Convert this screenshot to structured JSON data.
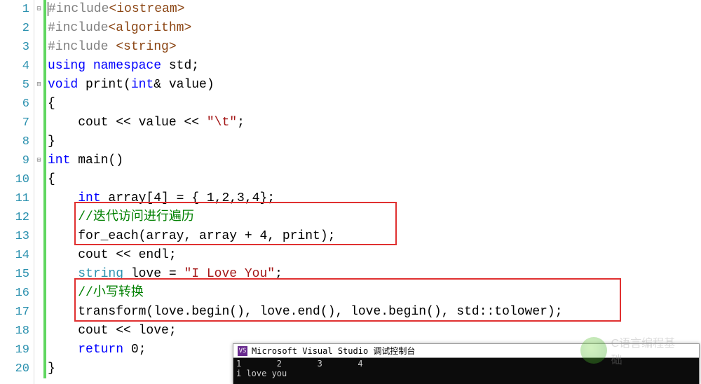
{
  "lines": {
    "count": 20
  },
  "code": {
    "l1": {
      "a": "#include",
      "b": "<iostream>"
    },
    "l2": {
      "a": "#include",
      "b": "<algorithm>"
    },
    "l3": {
      "a": "#include ",
      "b": "<string>"
    },
    "l4": {
      "a": "using",
      "b": " namespace",
      "c": " std;"
    },
    "l5": {
      "a": "void",
      "b": " print(",
      "c": "int",
      "d": "& value)"
    },
    "l6": "{",
    "l7": {
      "a": "    cout << value << ",
      "b": "\"\\t\"",
      "c": ";"
    },
    "l8": "}",
    "l9": {
      "a": "int",
      "b": " main()"
    },
    "l10": "{",
    "l11": {
      "a": "    ",
      "b": "int",
      "c": " array[4] = { 1,2,3,4};"
    },
    "l12": {
      "a": "    ",
      "b": "//迭代访问进行遍历"
    },
    "l13": {
      "a": "    for_each(array, array + 4, print);"
    },
    "l14": {
      "a": "    cout << endl;"
    },
    "l15": {
      "a": "    ",
      "b": "string",
      "c": " love = ",
      "d": "\"I Love You\"",
      "e": ";"
    },
    "l16": {
      "a": "    ",
      "b": "//小写转换"
    },
    "l17": {
      "a": "    transform(love.begin(), love.end(), love.begin(), std::tolower);"
    },
    "l18": {
      "a": "    cout << love;"
    },
    "l19": {
      "a": "    ",
      "b": "return",
      "c": " 0;"
    },
    "l20": "}"
  },
  "console": {
    "title": "Microsoft Visual Studio 调试控制台",
    "row1": "1       2       3       4",
    "row2": "i love you"
  },
  "watermark": {
    "text": "C语言编程基础"
  }
}
